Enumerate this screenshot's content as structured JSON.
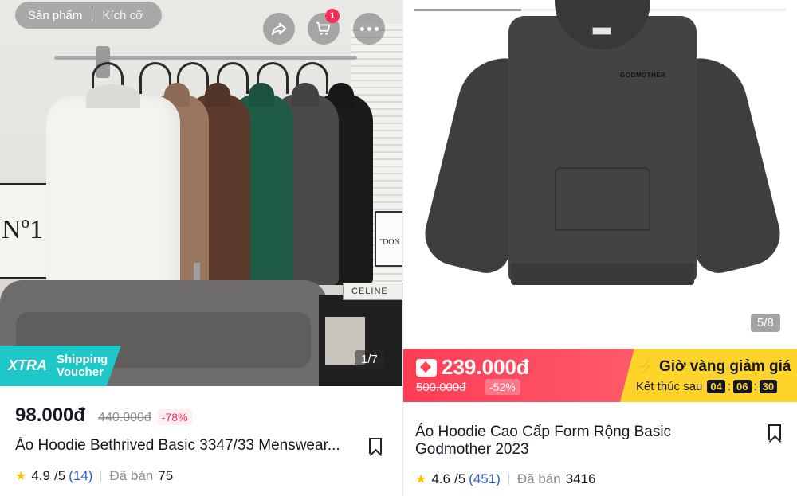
{
  "left_card": {
    "nav": {
      "tab_products": "Sản phẩm",
      "tab_size": "Kích cỡ"
    },
    "cart_badge": "1",
    "voucher": {
      "brand": "XTRA",
      "line1": "Shipping",
      "line2": "Voucher"
    },
    "image_counter": "1/7",
    "price": "98.000đ",
    "original_price": "440.000đ",
    "discount": "-78%",
    "title": "Áo Hoodie Bethrived Basic 3347/33 Menswear...",
    "rating": "4.9",
    "rating_max": "/5",
    "review_count": "(14)",
    "sold_label": "Đã bán",
    "sold_count": "75",
    "shop_signs": {
      "no1": "Nº1",
      "celine": "CELINE",
      "don": "\"DON"
    }
  },
  "right_card": {
    "image_counter": "5/8",
    "flash_price": "239.000đ",
    "flash_original_price": "500.000đ",
    "flash_discount": "-52%",
    "golden_hour_label": "Giờ vàng giảm giá",
    "ends_in_label": "Kết thúc sau",
    "timer": {
      "h": "04",
      "m": "06",
      "s": "30"
    },
    "title": "Áo Hoodie Cao Cấp Form Rộng Basic Godmother 2023",
    "rating": "4.6",
    "rating_max": "/5",
    "review_count": "(451)",
    "sold_label": "Đã bán",
    "sold_count": "3416",
    "brand_print": "GODMOTHER"
  },
  "colors": {
    "accent": "#fe2c55",
    "teal": "#1ec8c8",
    "gold": "#ffd42a",
    "star": "#fac000",
    "link": "#2f5dd8"
  },
  "icons": [
    "share-icon",
    "cart-icon",
    "more-icon",
    "bookmark-icon",
    "star-icon",
    "flash-icon",
    "ticket-icon"
  ]
}
